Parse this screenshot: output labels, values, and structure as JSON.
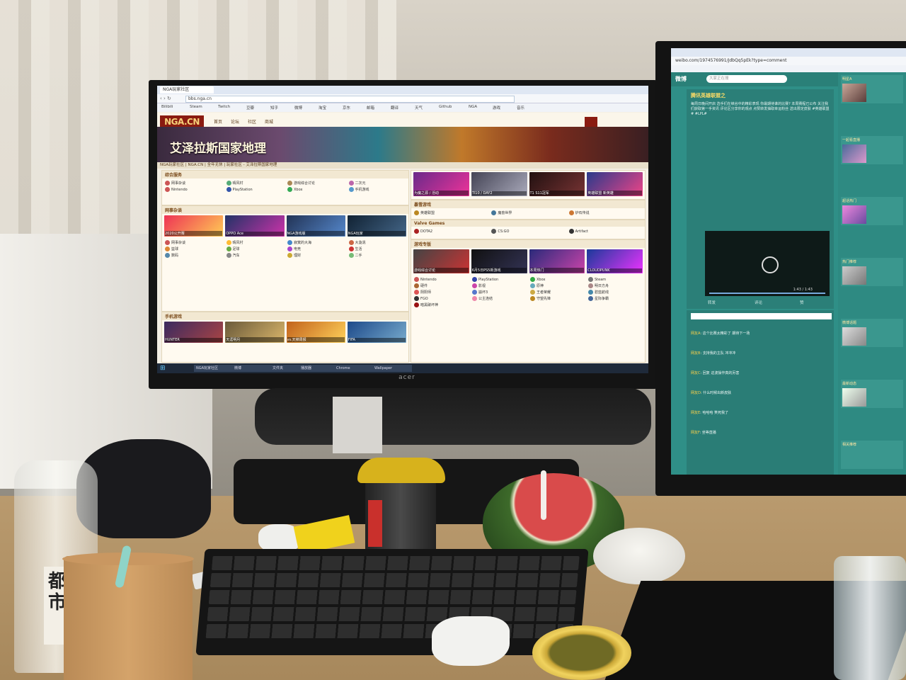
{
  "center_screen": {
    "tabs": [
      "NGA玩家社区",
      "",
      ""
    ],
    "address": "bbs.nga.cn",
    "bookmarks": [
      "Bilibili",
      "Steam",
      "Twitch",
      "豆瓣",
      "知乎",
      "微博",
      "淘宝",
      "京东",
      "邮箱",
      "翻译",
      "天气",
      "Github",
      "NGA",
      "游戏",
      "音乐"
    ],
    "logo": "NGA.CN",
    "nav": [
      "首页",
      "论坛",
      "社区",
      "商城"
    ],
    "banner_title": "艾泽拉斯国家地理",
    "breadcrumb": "NGA玩家社区 | NGA.CN | 全年无休 | 玩家社区 - 艾泽拉斯国家地理",
    "sections": [
      {
        "title": "综合服务",
        "forums": [
          "网事杂谈",
          "晴风村",
          "游戏综合讨论",
          "二次元",
          "Nintendo",
          "PlayStation",
          "Xbox",
          "手机游戏",
          "网络游戏",
          "Steam",
          "硬件",
          "影视"
        ]
      },
      {
        "title": "网事杂谈",
        "forums": [
          "网事杂谈",
          "晴风村",
          "寂寞的大海",
          "大漩涡",
          "篮球",
          "足球",
          "电竞",
          "生活",
          "数码",
          "汽车",
          "理财",
          "二手"
        ]
      },
      {
        "title": "手机游戏",
        "forums": [
          "原神",
          "明日方舟",
          "阴阳师",
          "崩坏3",
          "王者荣耀",
          "碧蓝航线",
          "FGO",
          "公主连结"
        ]
      }
    ],
    "right_sections": [
      "暴雪游戏",
      "Valve Games",
      "游戏专版"
    ],
    "right_forums": [
      "英雄联盟",
      "魔兽世界",
      "炉石传说",
      "守望先锋",
      "星际争霸",
      "暗黑破坏神",
      "DOTA2",
      "CS:GO",
      "Artifact"
    ],
    "top_thumbs": [
      "为魔之源 / 活动",
      "TI10 / DAY2",
      "T1 S11冠军",
      "英雄联盟 新英雄"
    ],
    "mid_thumbs": [
      "游戏综合讨论",
      "6月5日PS5新游戏",
      "本周热门",
      "CLOUDPUNK"
    ],
    "left_thumbs": [
      "2020公开赛",
      "OPPO Ace",
      "NGA游戏版",
      "NGA玩家"
    ],
    "bottom_thumbs": [
      "HUNTER",
      "天涯明月",
      "vs.天梯周报",
      "FIFA"
    ],
    "taskbar": [
      "NGA玩家社区",
      "微博",
      "文件夹",
      "播放器",
      "Chrome",
      "Wallpaper"
    ],
    "monitor_brand": "acer"
  },
  "right_screen": {
    "address": "weibo.com/1974576991/JdbQq5pEk?type=comment",
    "weibo_logo": "微博",
    "search_placeholder": "大家正在搜",
    "post_user": "腾讯英雄联盟之",
    "post_text": "每周日晚间开启 选手们在峡谷中的精彩表现 你最期待谁的比赛? 本周赛程已公布 关注我们获取第一手资讯 评论区分享你的观点 点赞转发抽取幸运粉丝 送出限定皮肤 #英雄联盟# #LPL#",
    "video_time": "1:43 / 1:43",
    "stats": [
      "转发",
      "评论",
      "赞"
    ],
    "comments": [
      {
        "user": "网友A",
        "text": "这个比赛太精彩了 期待下一场"
      },
      {
        "user": "网友B",
        "text": "支持我的主队 冲冲冲"
      },
      {
        "user": "网友C",
        "text": "回复 这波操作真的厉害"
      },
      {
        "user": "网友D",
        "text": "什么时候出新皮肤"
      },
      {
        "user": "网友E",
        "text": "哈哈哈 笑死我了"
      },
      {
        "user": "网友F",
        "text": "坐等直播"
      }
    ],
    "side_cards": [
      "明星A",
      "一起看直播",
      "超话热门",
      "热门推荐",
      "微博话题",
      "最新动态",
      "相关推荐"
    ]
  },
  "desk": {
    "bottle_text": "都市",
    "right_stand_text": ""
  }
}
